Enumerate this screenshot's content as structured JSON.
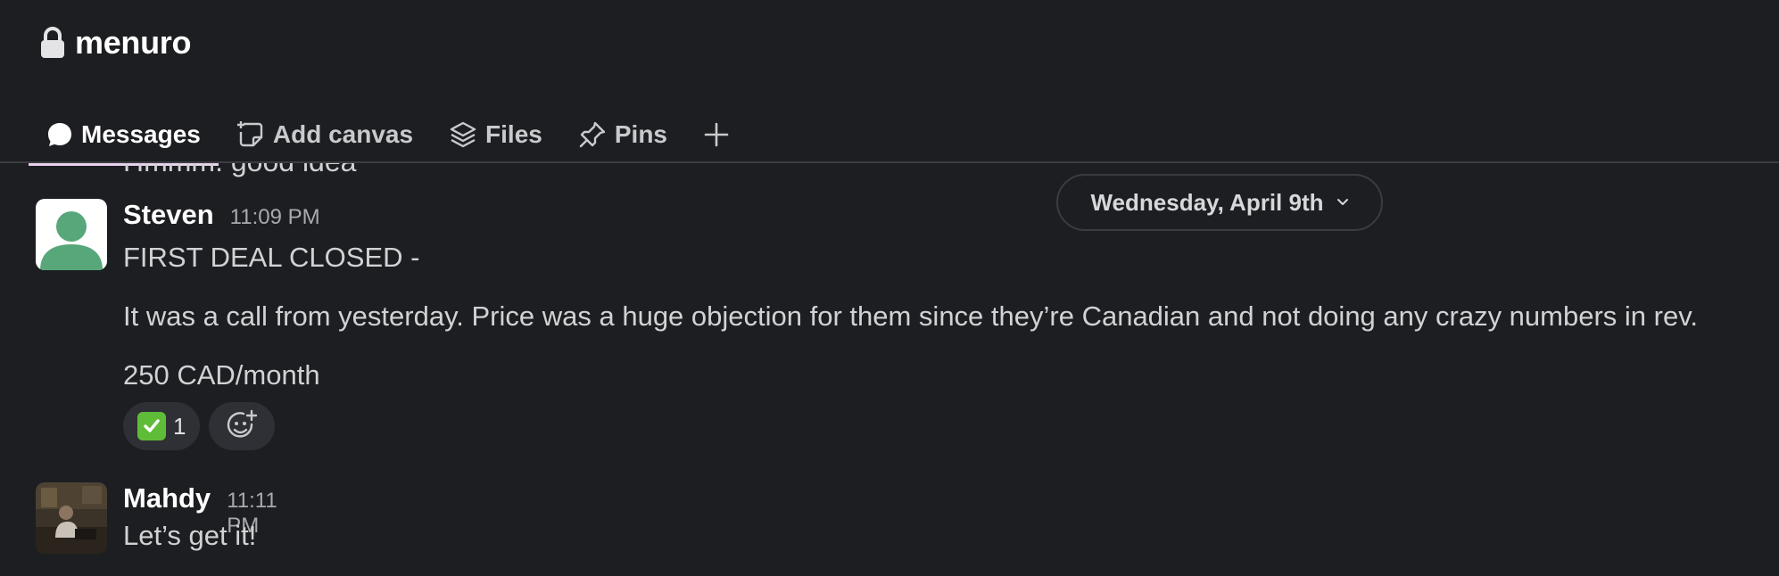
{
  "channel": {
    "name": "menuro",
    "lock_icon": "lock-icon"
  },
  "tabs": [
    {
      "label": "Messages",
      "icon": "message-bubble-icon",
      "active": true
    },
    {
      "label": "Add canvas",
      "icon": "canvas-icon",
      "active": false
    },
    {
      "label": "Files",
      "icon": "layers-icon",
      "active": false
    },
    {
      "label": "Pins",
      "icon": "pin-icon",
      "active": false
    }
  ],
  "add_tab_icon": "plus-icon",
  "date_divider": {
    "label": "Wednesday, April 9th",
    "icon": "chevron-down-icon"
  },
  "previous_message_peek": "Hmmm. good idea",
  "messages": [
    {
      "author": "Steven",
      "time": "11:09 PM",
      "avatar": "default-user-avatar",
      "lines": [
        "FIRST DEAL CLOSED -",
        "It was a call from yesterday. Price was a huge objection for them since they’re Canadian and not doing any crazy numbers in rev.",
        "250 CAD/month"
      ],
      "reactions": [
        {
          "emoji": "white-check-mark",
          "count": "1"
        }
      ]
    },
    {
      "author": "Mahdy",
      "time": "11:11 PM",
      "avatar": "photo-avatar",
      "lines": [
        "Let’s get it!"
      ]
    }
  ],
  "colors": {
    "background": "#1d1e22",
    "active_tab_underline": "#e8d1ee",
    "avatar_green": "#5a9c76",
    "reaction_bg": "#2f3035"
  }
}
